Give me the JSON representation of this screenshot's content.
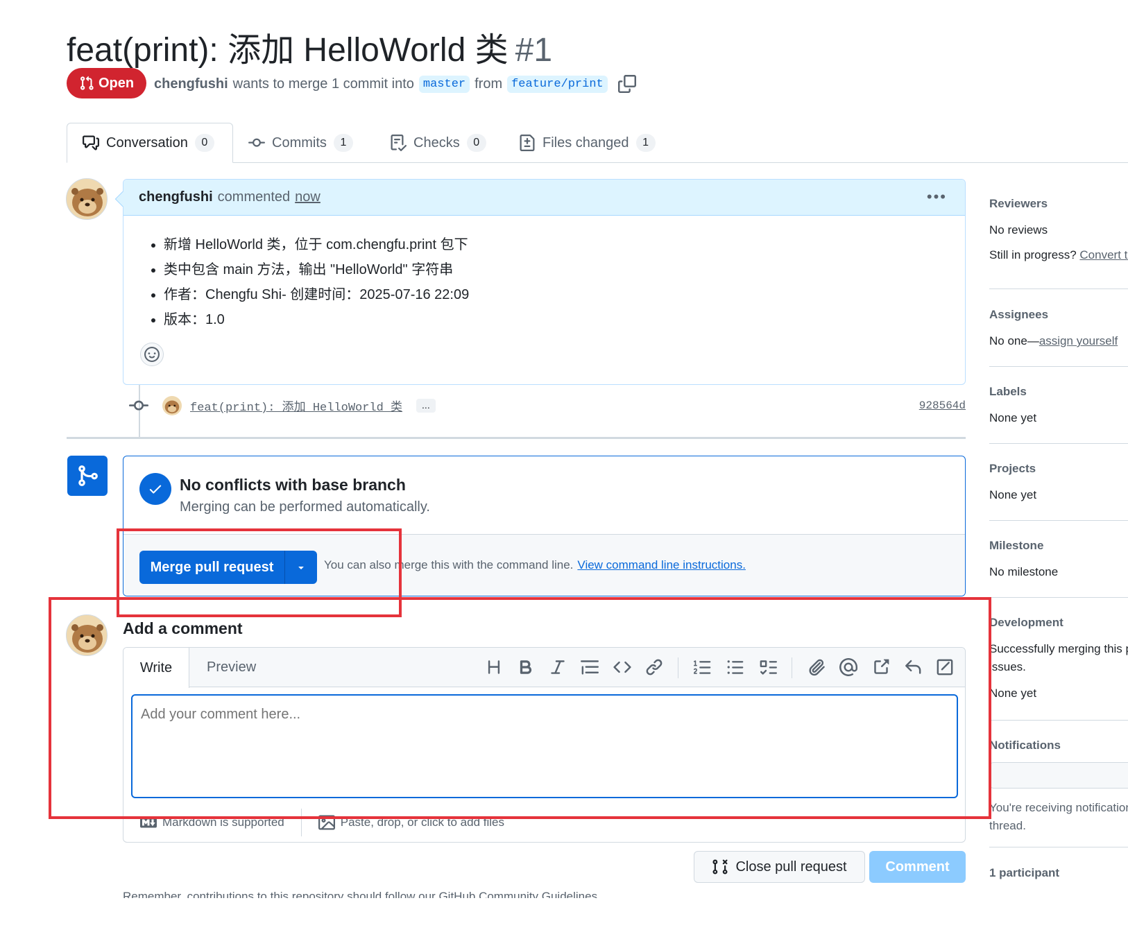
{
  "pr": {
    "title": "feat(print): 添加 HelloWorld 类",
    "number": "#1",
    "state": "Open",
    "author": "chengfushi",
    "merge_text": "wants to merge 1 commit into",
    "base_branch": "master",
    "from_text": "from",
    "head_branch": "feature/print"
  },
  "tabs": [
    {
      "label": "Conversation",
      "count": "0"
    },
    {
      "label": "Commits",
      "count": "1"
    },
    {
      "label": "Checks",
      "count": "0"
    },
    {
      "label": "Files changed",
      "count": "1"
    }
  ],
  "comment": {
    "author": "chengfushi",
    "action": "commented",
    "time": "now",
    "bullets": [
      "新增 HelloWorld 类，位于 com.chengfu.print 包下",
      "类中包含 main 方法，输出 \"HelloWorld\" 字符串",
      "作者：Chengfu Shi- 创建时间：2025-07-16 22:09",
      "版本：1.0"
    ]
  },
  "commit": {
    "message": "feat(print): 添加 HelloWorld 类",
    "more": "...",
    "sha": "928564d"
  },
  "merge": {
    "status_title": "No conflicts with base branch",
    "status_subtitle": "Merging can be performed automatically.",
    "button_label": "Merge pull request",
    "hint": "You can also merge this with the command line.",
    "hint_link": "View command line instructions."
  },
  "editor": {
    "heading": "Add a comment",
    "tab_write": "Write",
    "tab_preview": "Preview",
    "placeholder": "Add your comment here...",
    "markdown_note": "Markdown is supported",
    "files_note": "Paste, drop, or click to add files",
    "toolbar": [
      "heading-icon",
      "bold-icon",
      "italic-icon",
      "quote-icon",
      "code-icon",
      "link-icon",
      "ordered-list-icon",
      "unordered-list-icon",
      "task-list-icon",
      "attach-icon",
      "mention-icon",
      "reference-icon",
      "reply-icon",
      "fullscreen-icon"
    ]
  },
  "actions": {
    "close_label": "Close pull request",
    "comment_label": "Comment",
    "guidelines": "Remember, contributions to this repository should follow our GitHub Community Guidelines."
  },
  "sidebar": {
    "reviewers_h": "Reviewers",
    "reviewers_v": "No reviews",
    "reviewers_v2": "Still in progress?",
    "reviewers_link": "Convert to draft",
    "assignees_h": "Assignees",
    "assignees_v": "No one—",
    "assignees_link": "assign yourself",
    "labels_h": "Labels",
    "labels_v": "None yet",
    "projects_h": "Projects",
    "projects_v": "None yet",
    "milestone_h": "Milestone",
    "milestone_v": "No milestone",
    "development_h": "Development",
    "development_v1": "Successfully merging this pull request may close these",
    "development_v2": "issues.",
    "development_v3": "None yet",
    "notifications_h": "Notifications",
    "notifications_v1": "You're receiving notifications because you're watching this",
    "notifications_v2": "thread.",
    "participants_h": "1 participant"
  },
  "colors": {
    "open_red": "#d1242f",
    "accent_blue": "#0969da",
    "highlight_red": "#e5333b"
  }
}
